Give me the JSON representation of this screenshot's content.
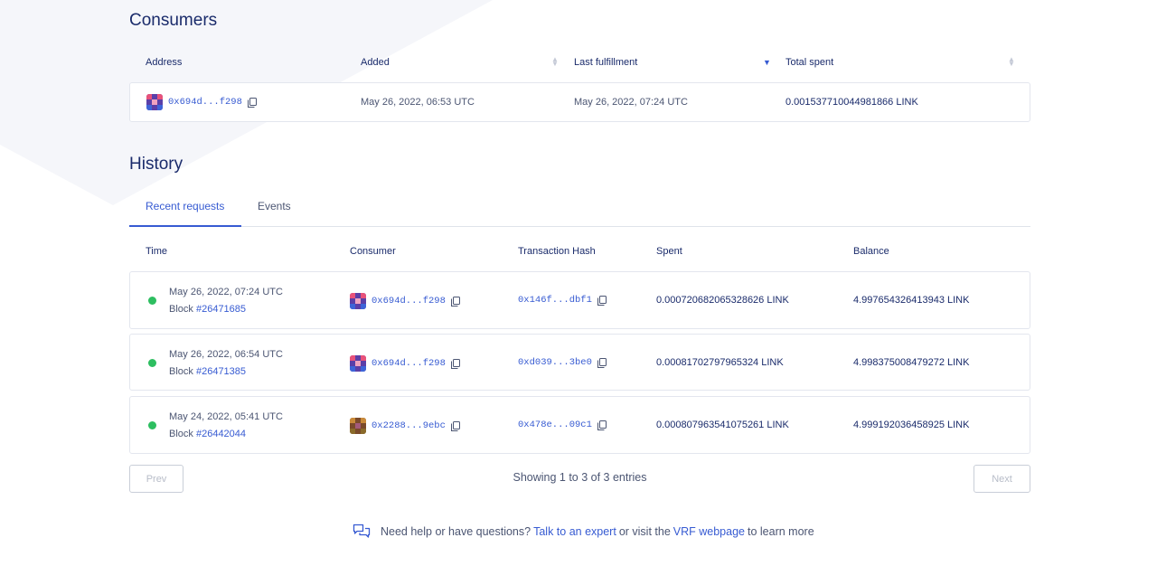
{
  "consumers": {
    "title": "Consumers",
    "columns": {
      "address": "Address",
      "added": "Added",
      "last_fulfillment": "Last fulfillment",
      "total_spent": "Total spent"
    },
    "rows": [
      {
        "address": "0x694d...f298",
        "added": "May 26, 2022, 06:53 UTC",
        "last_fulfillment": "May 26, 2022, 07:24 UTC",
        "total_spent": "0.001537710044981866 LINK"
      }
    ]
  },
  "history": {
    "title": "History",
    "tabs": [
      "Recent requests",
      "Events"
    ],
    "active_tab": 0,
    "columns": {
      "time": "Time",
      "consumer": "Consumer",
      "tx_hash": "Transaction Hash",
      "spent": "Spent",
      "balance": "Balance"
    },
    "block_label": "Block",
    "rows": [
      {
        "time": "May 26, 2022, 07:24 UTC",
        "block": "#26471685",
        "consumer": "0x694d...f298",
        "tx_hash": "0x146f...dbf1",
        "spent": "0.000720682065328626 LINK",
        "balance": "4.997654326413943 LINK"
      },
      {
        "time": "May 26, 2022, 06:54 UTC",
        "block": "#26471385",
        "consumer": "0x694d...f298",
        "tx_hash": "0xd039...3be0",
        "spent": "0.00081702797965324 LINK",
        "balance": "4.998375008479272 LINK"
      },
      {
        "time": "May 24, 2022, 05:41 UTC",
        "block": "#26442044",
        "consumer": "0x2288...9ebc",
        "tx_hash": "0x478e...09c1",
        "spent": "0.000807963541075261 LINK",
        "balance": "4.999192036458925 LINK"
      }
    ]
  },
  "pagination": {
    "prev": "Prev",
    "next": "Next",
    "showing": "Showing 1 to 3 of 3 entries"
  },
  "help": {
    "prefix": "Need help or have questions?",
    "expert_link": "Talk to an expert",
    "middle": "or visit the",
    "vrf_link": "VRF webpage",
    "suffix": "to learn more"
  },
  "colors": {
    "accent": "#375bd2",
    "status_ok": "#2dbe60",
    "heading": "#1a2b6b"
  },
  "icons": {
    "copy": "copy-icon",
    "help": "chat-bubbles-icon",
    "status": "status-dot",
    "sort": "sort-arrows-icon"
  }
}
